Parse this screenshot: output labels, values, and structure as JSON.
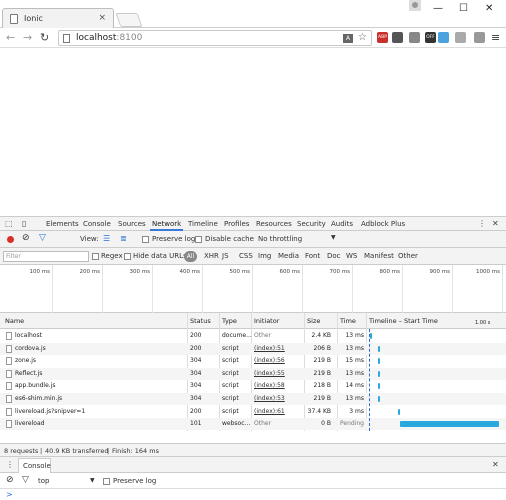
{
  "browser": {
    "tab_title": "Ionic",
    "tab_close": "×",
    "url_host": "localhost",
    "url_port": ":8100",
    "window_controls": {
      "minimize": "—",
      "maximize": "☐",
      "close": "✕"
    },
    "nav": {
      "back": "←",
      "forward": "→",
      "reload": "↻"
    },
    "extensions": [
      {
        "name": "abp-icon",
        "label": "ABP",
        "color": "#c9302c"
      },
      {
        "name": "extension-icon-2",
        "label": "",
        "color": "#555555"
      },
      {
        "name": "extension-icon-3",
        "label": "",
        "color": "#888888"
      },
      {
        "name": "off-icon",
        "label": "OFF",
        "color": "#333333"
      },
      {
        "name": "extension-icon-5",
        "label": "",
        "color": "#4aa3df"
      },
      {
        "name": "extension-icon-6",
        "label": "",
        "color": "#aaaaaa"
      },
      {
        "name": "extension-icon-7",
        "label": "",
        "color": "#999999"
      }
    ],
    "menu_icon": "≡"
  },
  "devtools": {
    "tabs": [
      "Elements",
      "Console",
      "Sources",
      "Network",
      "Timeline",
      "Profiles",
      "Resources",
      "Security",
      "Audits",
      "Adblock Plus"
    ],
    "active_tab": "Network",
    "more_icon": "⋮",
    "close_icon": "✕",
    "network_toolbar": {
      "view_label": "View:",
      "preserve_log": "Preserve log",
      "disable_cache": "Disable cache",
      "throttling": "No throttling"
    },
    "filter": {
      "placeholder": "Filter",
      "regex": "Regex",
      "hide_data_urls": "Hide data URLs",
      "all": "All",
      "types": [
        "XHR",
        "JS",
        "CSS",
        "Img",
        "Media",
        "Font",
        "Doc",
        "WS",
        "Manifest",
        "Other"
      ]
    },
    "overview_ticks": [
      "100 ms",
      "200 ms",
      "300 ms",
      "400 ms",
      "500 ms",
      "600 ms",
      "700 ms",
      "800 ms",
      "900 ms",
      "1000 ms"
    ],
    "columns": {
      "name": "Name",
      "status": "Status",
      "type": "Type",
      "initiator": "Initiator",
      "size": "Size",
      "time": "Time",
      "timeline": "Timeline – Start Time",
      "timeline_end": "1.00 s"
    },
    "requests": [
      {
        "name": "localhost",
        "status": "200",
        "type": "docume...",
        "initiator": "Other",
        "initiator_link": false,
        "size": "2.4 KB",
        "time": "13 ms",
        "wf_start": 0.008,
        "wf_len": 0.015
      },
      {
        "name": "cordova.js",
        "status": "200",
        "type": "script",
        "initiator": "(index):51",
        "initiator_link": true,
        "size": "206 B",
        "time": "13 ms",
        "wf_start": 0.07,
        "wf_len": 0.013
      },
      {
        "name": "zone.js",
        "status": "304",
        "type": "script",
        "initiator": "(index):56",
        "initiator_link": true,
        "size": "219 B",
        "time": "15 ms",
        "wf_start": 0.07,
        "wf_len": 0.015
      },
      {
        "name": "Reflect.js",
        "status": "304",
        "type": "script",
        "initiator": "(index):55",
        "initiator_link": true,
        "size": "219 B",
        "time": "13 ms",
        "wf_start": 0.07,
        "wf_len": 0.013
      },
      {
        "name": "app.bundle.js",
        "status": "304",
        "type": "script",
        "initiator": "(index):58",
        "initiator_link": true,
        "size": "218 B",
        "time": "14 ms",
        "wf_start": 0.07,
        "wf_len": 0.014
      },
      {
        "name": "es6-shim.min.js",
        "status": "304",
        "type": "script",
        "initiator": "(index):53",
        "initiator_link": true,
        "size": "219 B",
        "time": "13 ms",
        "wf_start": 0.07,
        "wf_len": 0.013
      },
      {
        "name": "livereload.js?snipver=1",
        "status": "200",
        "type": "script",
        "initiator": "(index):61",
        "initiator_link": true,
        "size": "37.4 KB",
        "time": "3 ms",
        "wf_start": 0.225,
        "wf_len": 0.01
      },
      {
        "name": "livereload",
        "status": "101",
        "type": "websoc...",
        "initiator": "Other",
        "initiator_link": false,
        "size": "0 B",
        "time": "Pending",
        "wf_start": 0.235,
        "wf_len": 0.765
      }
    ],
    "summary": {
      "requests": "8 requests",
      "transferred": "40.9 KB transferred",
      "finish": "Finish: 164 ms"
    },
    "drawer": {
      "tab": "Console",
      "context": "top",
      "preserve_log": "Preserve log",
      "prompt": ">"
    }
  }
}
